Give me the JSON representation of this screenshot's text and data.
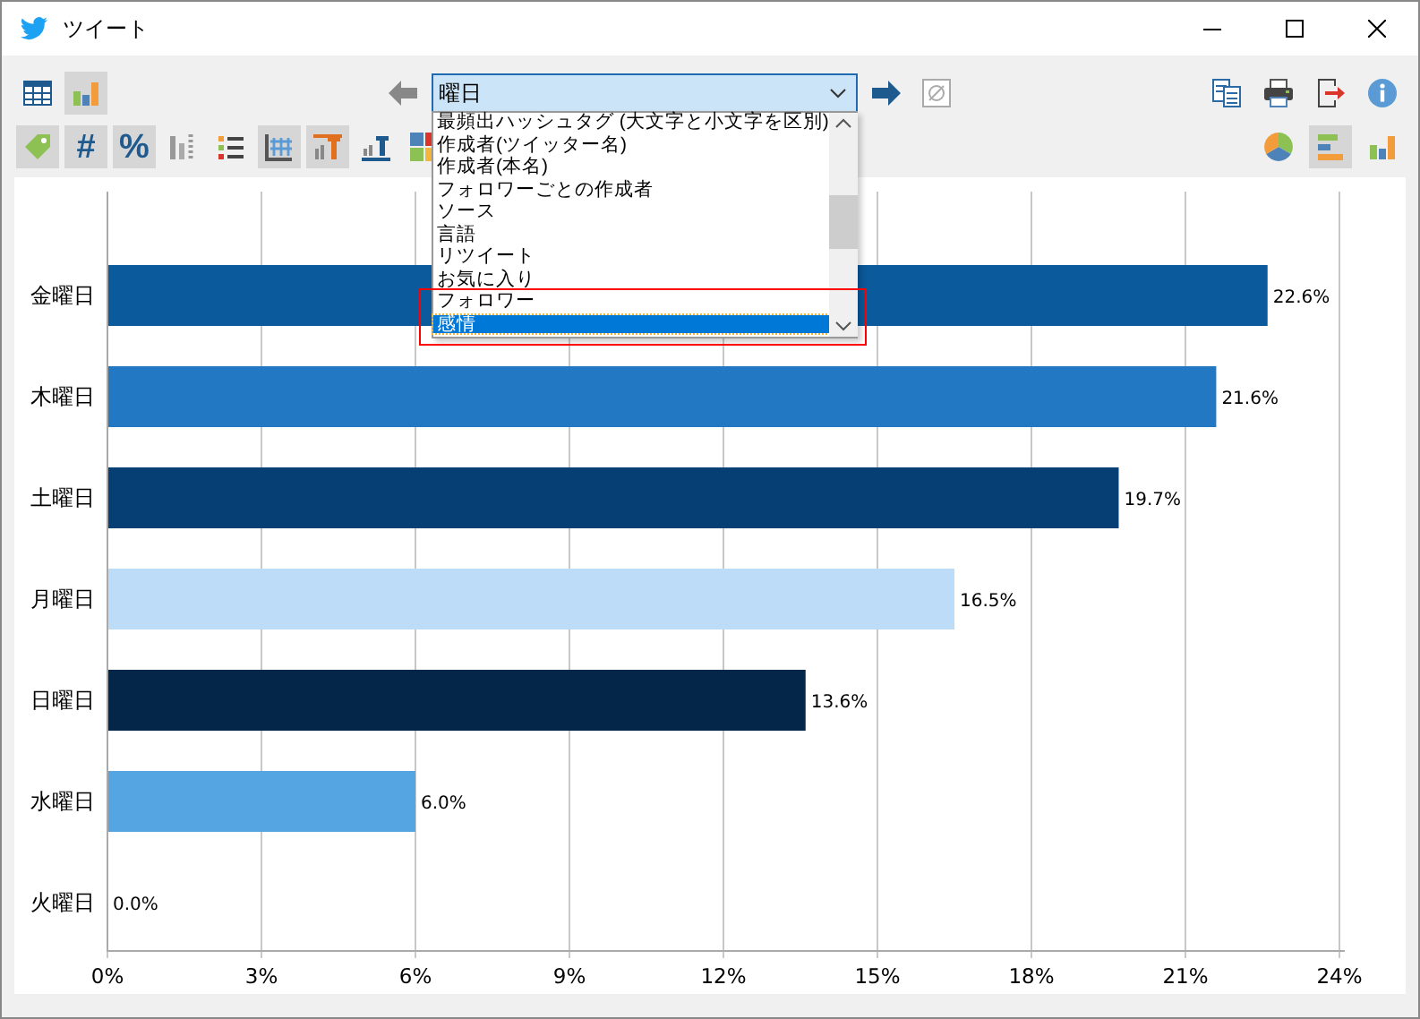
{
  "window": {
    "title": "ツイート"
  },
  "toolbar": {
    "row_1_left": [
      {
        "kind": "table",
        "selected": false
      },
      {
        "kind": "bar-chart",
        "selected": true
      }
    ],
    "row_1_right": [
      {
        "kind": "copy",
        "selected": false
      },
      {
        "kind": "print",
        "selected": false
      },
      {
        "kind": "export",
        "selected": false
      },
      {
        "kind": "info",
        "selected": false
      }
    ],
    "row_2_left": [
      {
        "kind": "tag",
        "selected": true
      },
      {
        "kind": "glyph",
        "glyph": "#",
        "selected": true
      },
      {
        "kind": "glyph",
        "glyph": "%",
        "selected": true
      },
      {
        "kind": "columns",
        "selected": false
      },
      {
        "kind": "list",
        "selected": false
      },
      {
        "kind": "grid",
        "selected": true
      },
      {
        "kind": "top-t",
        "selected": true
      },
      {
        "kind": "bottom-t",
        "selected": false
      },
      {
        "kind": "tiles",
        "selected": false
      }
    ],
    "row_2_right": [
      {
        "kind": "pie",
        "selected": false
      },
      {
        "kind": "hbar",
        "selected": true
      },
      {
        "kind": "vbar",
        "selected": false
      }
    ]
  },
  "field_selector": {
    "value": "曜日",
    "clear_disabled": true,
    "options": [
      {
        "label": "最頻出ハッシュタグ (大文字と小文字を区別)",
        "selected": false
      },
      {
        "label": "作成者(ツイッター名)",
        "selected": false
      },
      {
        "label": "作成者(本名)",
        "selected": false
      },
      {
        "label": "フォロワーごとの作成者",
        "selected": false
      },
      {
        "label": "ソース",
        "selected": false
      },
      {
        "label": "言語",
        "selected": false
      },
      {
        "label": "リツイート",
        "selected": false
      },
      {
        "label": "お気に入り",
        "selected": false
      },
      {
        "label": "フォロワー",
        "selected": false
      },
      {
        "label": "感情",
        "selected": true
      }
    ]
  },
  "chart_data": {
    "type": "bar",
    "orientation": "horizontal",
    "categories": [
      "金曜日",
      "木曜日",
      "土曜日",
      "月曜日",
      "日曜日",
      "水曜日",
      "火曜日"
    ],
    "grid": true,
    "series": [
      {
        "color": "#0a5a9c",
        "values": [
          22.6,
          null,
          null,
          null,
          null,
          null,
          null
        ]
      },
      {
        "color": "#2378c3",
        "values": [
          null,
          21.6,
          null,
          null,
          null,
          null,
          null
        ]
      },
      {
        "color": "#053f73",
        "values": [
          null,
          null,
          19.7,
          null,
          null,
          null,
          null
        ]
      },
      {
        "color": "#bddcf7",
        "values": [
          null,
          null,
          null,
          16.5,
          null,
          null,
          null
        ]
      },
      {
        "color": "#042749",
        "values": [
          null,
          null,
          null,
          null,
          13.6,
          null,
          null
        ]
      },
      {
        "color": "#56a5e3",
        "values": [
          null,
          null,
          null,
          null,
          null,
          6.0,
          0.0
        ]
      }
    ],
    "xlim": [
      0,
      24
    ],
    "xticks": [
      {
        "value": 0,
        "label": "0%"
      },
      {
        "value": 3,
        "label": "3%"
      },
      {
        "value": 6,
        "label": "6%"
      },
      {
        "value": 9,
        "label": "9%"
      },
      {
        "value": 12,
        "label": "12%"
      },
      {
        "value": 15,
        "label": "15%"
      },
      {
        "value": 18,
        "label": "18%"
      },
      {
        "value": 21,
        "label": "21%"
      },
      {
        "value": 24,
        "label": "24%"
      }
    ],
    "value_labels": [
      "22.6%",
      "21.6%",
      "19.7%",
      "16.5%",
      "13.6%",
      "6.0%",
      "0.0%"
    ]
  }
}
